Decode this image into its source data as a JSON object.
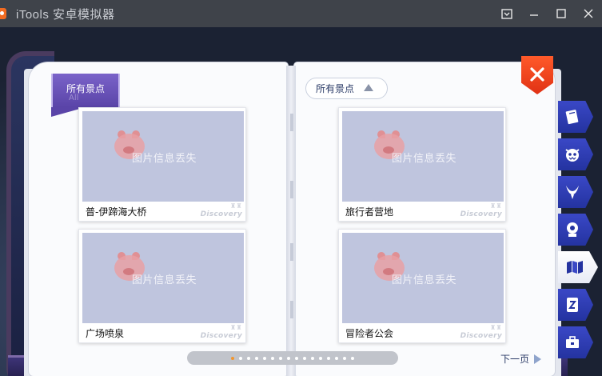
{
  "window": {
    "title": "iTools 安卓模拟器",
    "controls": [
      "minimize-to-tray",
      "minimize",
      "maximize",
      "close"
    ]
  },
  "ribbon": {
    "label": "所有景点",
    "sublabel": "All"
  },
  "category_filter": {
    "label": "所有景点"
  },
  "cards": [
    {
      "caption": "普-伊蹄海大桥",
      "image_text": "图片信息丢失",
      "watermark": "Discovery"
    },
    {
      "caption": "广场喷泉",
      "image_text": "图片信息丢失",
      "watermark": "Discovery"
    },
    {
      "caption": "旅行者营地",
      "image_text": "图片信息丢失",
      "watermark": "Discovery"
    },
    {
      "caption": "冒险者公会",
      "image_text": "图片信息丢失",
      "watermark": "Discovery"
    }
  ],
  "pagination": {
    "total_pages": 16,
    "current_page": 1,
    "next_label": "下一页"
  },
  "side_tabs": [
    {
      "icon": "book-icon",
      "active": false
    },
    {
      "icon": "monster-face-icon",
      "active": false
    },
    {
      "icon": "horns-icon",
      "active": false
    },
    {
      "icon": "npc-icon",
      "active": false
    },
    {
      "icon": "flag-map-icon",
      "active": true
    },
    {
      "icon": "card-icon",
      "active": false
    },
    {
      "icon": "toolbox-icon",
      "active": false
    }
  ],
  "colors": {
    "titlebar": "#3f434a",
    "accent_close": "#e8401d",
    "side_tab": "#2e3bb5",
    "ribbon": "#6a54b8",
    "image_placeholder": "#bfc5de",
    "pager_active_dot": "#f2962f"
  }
}
